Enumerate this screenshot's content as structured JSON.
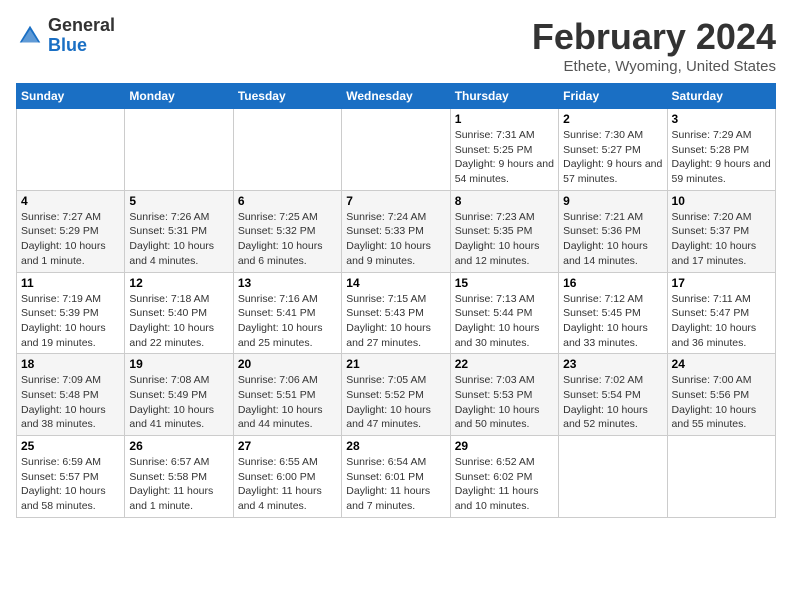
{
  "header": {
    "logo": {
      "general": "General",
      "blue": "Blue"
    },
    "title": "February 2024",
    "location": "Ethete, Wyoming, United States"
  },
  "weekdays": [
    "Sunday",
    "Monday",
    "Tuesday",
    "Wednesday",
    "Thursday",
    "Friday",
    "Saturday"
  ],
  "weeks": [
    [
      {
        "day": null
      },
      {
        "day": null
      },
      {
        "day": null
      },
      {
        "day": null
      },
      {
        "day": 1,
        "sunrise": "7:31 AM",
        "sunset": "5:25 PM",
        "daylight": "9 hours and 54 minutes."
      },
      {
        "day": 2,
        "sunrise": "7:30 AM",
        "sunset": "5:27 PM",
        "daylight": "9 hours and 57 minutes."
      },
      {
        "day": 3,
        "sunrise": "7:29 AM",
        "sunset": "5:28 PM",
        "daylight": "9 hours and 59 minutes."
      }
    ],
    [
      {
        "day": 4,
        "sunrise": "7:27 AM",
        "sunset": "5:29 PM",
        "daylight": "10 hours and 1 minute."
      },
      {
        "day": 5,
        "sunrise": "7:26 AM",
        "sunset": "5:31 PM",
        "daylight": "10 hours and 4 minutes."
      },
      {
        "day": 6,
        "sunrise": "7:25 AM",
        "sunset": "5:32 PM",
        "daylight": "10 hours and 6 minutes."
      },
      {
        "day": 7,
        "sunrise": "7:24 AM",
        "sunset": "5:33 PM",
        "daylight": "10 hours and 9 minutes."
      },
      {
        "day": 8,
        "sunrise": "7:23 AM",
        "sunset": "5:35 PM",
        "daylight": "10 hours and 12 minutes."
      },
      {
        "day": 9,
        "sunrise": "7:21 AM",
        "sunset": "5:36 PM",
        "daylight": "10 hours and 14 minutes."
      },
      {
        "day": 10,
        "sunrise": "7:20 AM",
        "sunset": "5:37 PM",
        "daylight": "10 hours and 17 minutes."
      }
    ],
    [
      {
        "day": 11,
        "sunrise": "7:19 AM",
        "sunset": "5:39 PM",
        "daylight": "10 hours and 19 minutes."
      },
      {
        "day": 12,
        "sunrise": "7:18 AM",
        "sunset": "5:40 PM",
        "daylight": "10 hours and 22 minutes."
      },
      {
        "day": 13,
        "sunrise": "7:16 AM",
        "sunset": "5:41 PM",
        "daylight": "10 hours and 25 minutes."
      },
      {
        "day": 14,
        "sunrise": "7:15 AM",
        "sunset": "5:43 PM",
        "daylight": "10 hours and 27 minutes."
      },
      {
        "day": 15,
        "sunrise": "7:13 AM",
        "sunset": "5:44 PM",
        "daylight": "10 hours and 30 minutes."
      },
      {
        "day": 16,
        "sunrise": "7:12 AM",
        "sunset": "5:45 PM",
        "daylight": "10 hours and 33 minutes."
      },
      {
        "day": 17,
        "sunrise": "7:11 AM",
        "sunset": "5:47 PM",
        "daylight": "10 hours and 36 minutes."
      }
    ],
    [
      {
        "day": 18,
        "sunrise": "7:09 AM",
        "sunset": "5:48 PM",
        "daylight": "10 hours and 38 minutes."
      },
      {
        "day": 19,
        "sunrise": "7:08 AM",
        "sunset": "5:49 PM",
        "daylight": "10 hours and 41 minutes."
      },
      {
        "day": 20,
        "sunrise": "7:06 AM",
        "sunset": "5:51 PM",
        "daylight": "10 hours and 44 minutes."
      },
      {
        "day": 21,
        "sunrise": "7:05 AM",
        "sunset": "5:52 PM",
        "daylight": "10 hours and 47 minutes."
      },
      {
        "day": 22,
        "sunrise": "7:03 AM",
        "sunset": "5:53 PM",
        "daylight": "10 hours and 50 minutes."
      },
      {
        "day": 23,
        "sunrise": "7:02 AM",
        "sunset": "5:54 PM",
        "daylight": "10 hours and 52 minutes."
      },
      {
        "day": 24,
        "sunrise": "7:00 AM",
        "sunset": "5:56 PM",
        "daylight": "10 hours and 55 minutes."
      }
    ],
    [
      {
        "day": 25,
        "sunrise": "6:59 AM",
        "sunset": "5:57 PM",
        "daylight": "10 hours and 58 minutes."
      },
      {
        "day": 26,
        "sunrise": "6:57 AM",
        "sunset": "5:58 PM",
        "daylight": "11 hours and 1 minute."
      },
      {
        "day": 27,
        "sunrise": "6:55 AM",
        "sunset": "6:00 PM",
        "daylight": "11 hours and 4 minutes."
      },
      {
        "day": 28,
        "sunrise": "6:54 AM",
        "sunset": "6:01 PM",
        "daylight": "11 hours and 7 minutes."
      },
      {
        "day": 29,
        "sunrise": "6:52 AM",
        "sunset": "6:02 PM",
        "daylight": "11 hours and 10 minutes."
      },
      {
        "day": null
      },
      {
        "day": null
      }
    ]
  ],
  "labels": {
    "sunrise": "Sunrise:",
    "sunset": "Sunset:",
    "daylight": "Daylight:"
  }
}
